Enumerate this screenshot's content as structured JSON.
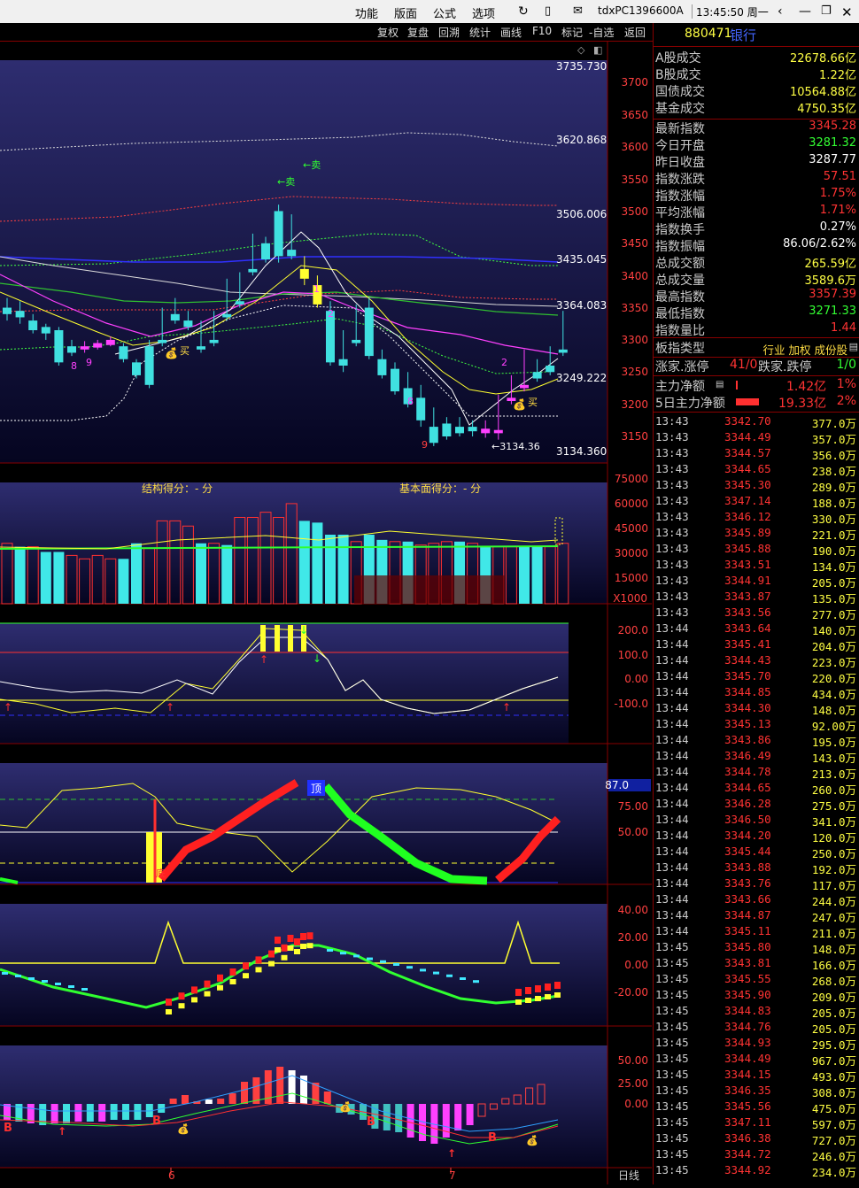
{
  "menu": {
    "items": [
      "功能",
      "版面",
      "公式",
      "选项"
    ],
    "terminal": "tdxPC1396600A",
    "clock": "13:45:50 周一"
  },
  "toolbar": {
    "buttons": [
      "复权",
      "复盘",
      "回溯",
      "统计",
      "画线",
      "F10",
      "标记",
      "-自选",
      "返回"
    ]
  },
  "main_chart": {
    "price_labels": [
      "3735.730",
      "3620.868",
      "3506.006",
      "3435.045",
      "3364.083",
      "3249.222",
      "3134.360"
    ],
    "axis_ticks": [
      "3700",
      "3650",
      "3600",
      "3550",
      "3500",
      "3450",
      "3400",
      "3350",
      "3300",
      "3250",
      "3200",
      "3150"
    ],
    "annotations": {
      "sell1": "←卖",
      "sell2": "←卖",
      "buy1": "买",
      "buy2": "买",
      "low": "←3134.36"
    }
  },
  "volume_panel": {
    "left_title": "结构得分：- 分",
    "right_title": "基本面得分：- 分",
    "ticks": [
      "75000",
      "60000",
      "45000",
      "30000",
      "15000"
    ],
    "unit": "X1000"
  },
  "ind1": {
    "ticks": [
      "200.0",
      "100.0",
      "0.00",
      "-100.0"
    ]
  },
  "ind2": {
    "ticks": [
      "87.0",
      "75.00",
      "50.00"
    ],
    "top_label": "顶",
    "bottom_label": "底"
  },
  "ind3": {
    "ticks": [
      "40.00",
      "20.00",
      "0.00",
      "-20.00"
    ]
  },
  "ind4": {
    "ticks": [
      "50.00",
      "25.00",
      "0.00"
    ]
  },
  "date_axis": {
    "labels": [
      "6",
      "7"
    ],
    "period": "日线"
  },
  "right_panel": {
    "code": "880471",
    "name": "银行",
    "rows": [
      {
        "label": "A股成交",
        "value": "22678.66亿",
        "color": "#ffff44"
      },
      {
        "label": "B股成交",
        "value": "1.22亿",
        "color": "#ffff44"
      },
      {
        "label": "国债成交",
        "value": "10564.88亿",
        "color": "#ffff44"
      },
      {
        "label": "基金成交",
        "value": "4750.35亿",
        "color": "#ffff44"
      },
      {
        "label": "最新指数",
        "value": "3345.28",
        "color": "#ff3333"
      },
      {
        "label": "今日开盘",
        "value": "3281.32",
        "color": "#33ff33"
      },
      {
        "label": "昨日收盘",
        "value": "3287.77",
        "color": "#ffffff"
      },
      {
        "label": "指数涨跌",
        "value": "57.51",
        "color": "#ff3333"
      },
      {
        "label": "指数涨幅",
        "value": "1.75%",
        "color": "#ff3333"
      },
      {
        "label": "平均涨幅",
        "value": "1.71%",
        "color": "#ff3333"
      },
      {
        "label": "指数换手",
        "value": "0.27%",
        "color": "#ffffff"
      },
      {
        "label": "指数振幅",
        "value": "86.06/2.62%",
        "color": "#ffffff"
      },
      {
        "label": "总成交额",
        "value": "265.59亿",
        "color": "#ffff44"
      },
      {
        "label": "总成交量",
        "value": "3589.6万",
        "color": "#ffff44"
      },
      {
        "label": "最高指数",
        "value": "3357.39",
        "color": "#ff3333"
      },
      {
        "label": "最低指数",
        "value": "3271.33",
        "color": "#33ff33"
      },
      {
        "label": "指数量比",
        "value": "1.44",
        "color": "#ff3333"
      }
    ],
    "type_row": {
      "label": "板指类型",
      "value": "行业 加权 成份股"
    },
    "updown_row": {
      "label1": "涨家.涨停",
      "value1": "41/0",
      "label2": "跌家.跌停",
      "value2": "1/0"
    },
    "flow_rows": [
      {
        "label": "主力净额",
        "amount": "1.42亿",
        "pct": "1%"
      },
      {
        "label": "5日主力净额",
        "amount": "19.33亿",
        "pct": "2%"
      }
    ],
    "ticks": [
      [
        "13:43",
        "3342.70",
        "377.0万"
      ],
      [
        "13:43",
        "3344.49",
        "357.0万"
      ],
      [
        "13:43",
        "3344.57",
        "356.0万"
      ],
      [
        "13:43",
        "3344.65",
        "238.0万"
      ],
      [
        "13:43",
        "3345.30",
        "289.0万"
      ],
      [
        "13:43",
        "3347.14",
        "188.0万"
      ],
      [
        "13:43",
        "3346.12",
        "330.0万"
      ],
      [
        "13:43",
        "3345.89",
        "221.0万"
      ],
      [
        "13:43",
        "3345.88",
        "190.0万"
      ],
      [
        "13:43",
        "3343.51",
        "134.0万"
      ],
      [
        "13:43",
        "3344.91",
        "205.0万"
      ],
      [
        "13:43",
        "3343.87",
        "135.0万"
      ],
      [
        "13:43",
        "3343.56",
        "277.0万"
      ],
      [
        "13:44",
        "3343.64",
        "140.0万"
      ],
      [
        "13:44",
        "3345.41",
        "204.0万"
      ],
      [
        "13:44",
        "3344.43",
        "223.0万"
      ],
      [
        "13:44",
        "3345.70",
        "220.0万"
      ],
      [
        "13:44",
        "3344.85",
        "434.0万"
      ],
      [
        "13:44",
        "3344.30",
        "148.0万"
      ],
      [
        "13:44",
        "3345.13",
        "92.00万"
      ],
      [
        "13:44",
        "3343.86",
        "195.0万"
      ],
      [
        "13:44",
        "3346.49",
        "143.0万"
      ],
      [
        "13:44",
        "3344.78",
        "213.0万"
      ],
      [
        "13:44",
        "3344.65",
        "260.0万"
      ],
      [
        "13:44",
        "3346.28",
        "275.0万"
      ],
      [
        "13:44",
        "3346.50",
        "341.0万"
      ],
      [
        "13:44",
        "3344.20",
        "120.0万"
      ],
      [
        "13:44",
        "3345.44",
        "250.0万"
      ],
      [
        "13:44",
        "3343.88",
        "192.0万"
      ],
      [
        "13:44",
        "3343.76",
        "117.0万"
      ],
      [
        "13:44",
        "3343.66",
        "244.0万"
      ],
      [
        "13:44",
        "3344.87",
        "247.0万"
      ],
      [
        "13:44",
        "3345.11",
        "211.0万"
      ],
      [
        "13:45",
        "3345.80",
        "148.0万"
      ],
      [
        "13:45",
        "3343.81",
        "166.0万"
      ],
      [
        "13:45",
        "3345.55",
        "268.0万"
      ],
      [
        "13:45",
        "3345.90",
        "209.0万"
      ],
      [
        "13:45",
        "3344.83",
        "205.0万"
      ],
      [
        "13:45",
        "3344.76",
        "205.0万"
      ],
      [
        "13:45",
        "3344.93",
        "295.0万"
      ],
      [
        "13:45",
        "3344.49",
        "967.0万"
      ],
      [
        "13:45",
        "3344.15",
        "493.0万"
      ],
      [
        "13:45",
        "3346.35",
        "308.0万"
      ],
      [
        "13:45",
        "3345.56",
        "475.0万"
      ],
      [
        "13:45",
        "3347.11",
        "597.0万"
      ],
      [
        "13:45",
        "3346.38",
        "727.0万"
      ],
      [
        "13:45",
        "3344.72",
        "246.0万"
      ],
      [
        "13:45",
        "3344.92",
        "234.0万"
      ]
    ]
  },
  "chart_data": {
    "type": "candlestick",
    "series": [
      {
        "name": "ohlc",
        "values": [
          [
            3350,
            3365,
            3340,
            3330
          ],
          [
            3345,
            3360,
            3335,
            3325
          ],
          [
            3330,
            3340,
            3315,
            3310
          ],
          [
            3320,
            3325,
            3310,
            3300
          ],
          [
            3315,
            3320,
            3265,
            3260
          ],
          [
            3290,
            3300,
            3280,
            3275
          ],
          [
            3290,
            3298,
            3285,
            3280
          ],
          [
            3295,
            3300,
            3288,
            3285
          ],
          [
            3300,
            3305,
            3292,
            3290
          ],
          [
            3290,
            3295,
            3270,
            3265
          ],
          [
            3265,
            3270,
            3245,
            3240
          ],
          [
            3290,
            3300,
            3230,
            3225
          ],
          [
            3300,
            3350,
            3295,
            3290
          ],
          [
            3340,
            3365,
            3330,
            3325
          ],
          [
            3330,
            3345,
            3320,
            3315
          ],
          [
            3290,
            3330,
            3285,
            3280
          ],
          [
            3300,
            3345,
            3295,
            3290
          ],
          [
            3340,
            3395,
            3335,
            3330
          ],
          [
            3360,
            3405,
            3355,
            3350
          ],
          [
            3410,
            3465,
            3405,
            3400
          ],
          [
            3450,
            3460,
            3425,
            3420
          ],
          [
            3500,
            3510,
            3430,
            3420
          ],
          [
            3440,
            3495,
            3430,
            3425
          ],
          [
            3410,
            3430,
            3395,
            3385
          ],
          [
            3385,
            3400,
            3355,
            3350
          ],
          [
            3345,
            3360,
            3265,
            3260
          ],
          [
            3270,
            3315,
            3260,
            3250
          ],
          [
            3300,
            3355,
            3295,
            3290
          ],
          [
            3350,
            3365,
            3275,
            3270
          ],
          [
            3270,
            3285,
            3245,
            3240
          ],
          [
            3255,
            3265,
            3220,
            3215
          ],
          [
            3225,
            3250,
            3200,
            3195
          ],
          [
            3210,
            3230,
            3175,
            3165
          ],
          [
            3165,
            3195,
            3140,
            3135
          ],
          [
            3170,
            3180,
            3150,
            3145
          ],
          [
            3165,
            3180,
            3155,
            3150
          ],
          [
            3165,
            3175,
            3158,
            3150
          ],
          [
            3162,
            3175,
            3155,
            3148
          ],
          [
            3160,
            3215,
            3155,
            3145
          ],
          [
            3210,
            3245,
            3205,
            3200
          ],
          [
            3230,
            3285,
            3225,
            3220
          ],
          [
            3250,
            3270,
            3240,
            3235
          ],
          [
            3260,
            3290,
            3250,
            3245
          ],
          [
            3285,
            3345,
            3280,
            3275
          ]
        ]
      }
    ],
    "ylim": [
      3134.36,
      3735.73
    ]
  }
}
